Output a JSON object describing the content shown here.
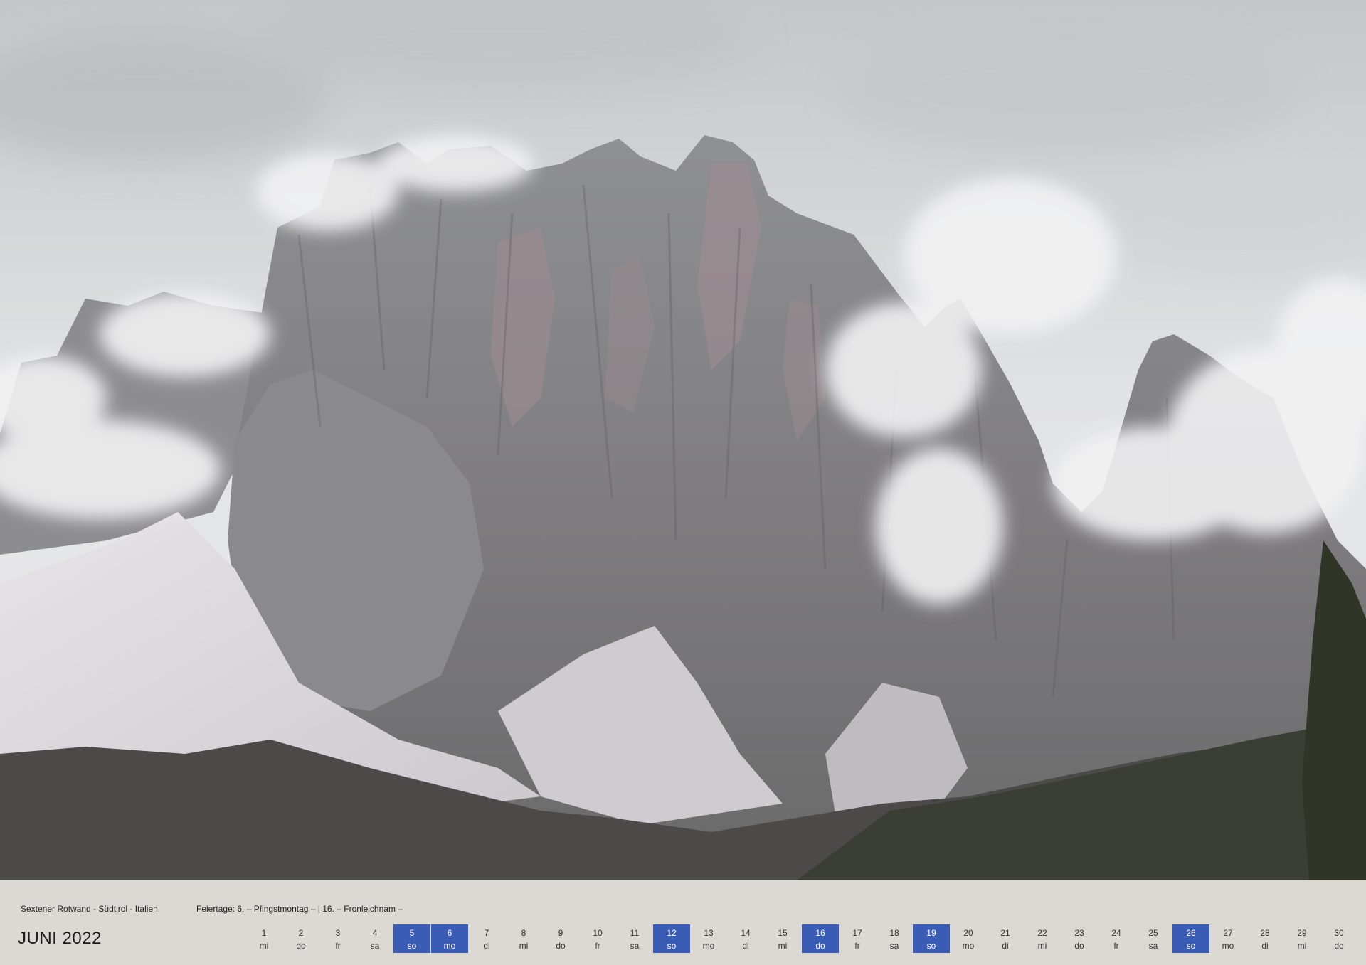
{
  "calendar": {
    "location": "Sextener Rotwand - Südtirol - Italien",
    "holidays": "Feiertage:  6. – Pfingstmontag – | 16. – Fronleichnam –",
    "month_label": "JUNI 2022",
    "highlight_color": "#3a5cb4",
    "days": [
      {
        "num": "1",
        "wd": "mi",
        "hl": false
      },
      {
        "num": "2",
        "wd": "do",
        "hl": false
      },
      {
        "num": "3",
        "wd": "fr",
        "hl": false
      },
      {
        "num": "4",
        "wd": "sa",
        "hl": false
      },
      {
        "num": "5",
        "wd": "so",
        "hl": true
      },
      {
        "num": "6",
        "wd": "mo",
        "hl": true
      },
      {
        "num": "7",
        "wd": "di",
        "hl": false
      },
      {
        "num": "8",
        "wd": "mi",
        "hl": false
      },
      {
        "num": "9",
        "wd": "do",
        "hl": false
      },
      {
        "num": "10",
        "wd": "fr",
        "hl": false
      },
      {
        "num": "11",
        "wd": "sa",
        "hl": false
      },
      {
        "num": "12",
        "wd": "so",
        "hl": true
      },
      {
        "num": "13",
        "wd": "mo",
        "hl": false
      },
      {
        "num": "14",
        "wd": "di",
        "hl": false
      },
      {
        "num": "15",
        "wd": "mi",
        "hl": false
      },
      {
        "num": "16",
        "wd": "do",
        "hl": true
      },
      {
        "num": "17",
        "wd": "fr",
        "hl": false
      },
      {
        "num": "18",
        "wd": "sa",
        "hl": false
      },
      {
        "num": "19",
        "wd": "so",
        "hl": true
      },
      {
        "num": "20",
        "wd": "mo",
        "hl": false
      },
      {
        "num": "21",
        "wd": "di",
        "hl": false
      },
      {
        "num": "22",
        "wd": "mi",
        "hl": false
      },
      {
        "num": "23",
        "wd": "do",
        "hl": false
      },
      {
        "num": "24",
        "wd": "fr",
        "hl": false
      },
      {
        "num": "25",
        "wd": "sa",
        "hl": false
      },
      {
        "num": "26",
        "wd": "so",
        "hl": true
      },
      {
        "num": "27",
        "wd": "mo",
        "hl": false
      },
      {
        "num": "28",
        "wd": "di",
        "hl": false
      },
      {
        "num": "29",
        "wd": "mi",
        "hl": false
      },
      {
        "num": "30",
        "wd": "do",
        "hl": false
      }
    ]
  }
}
